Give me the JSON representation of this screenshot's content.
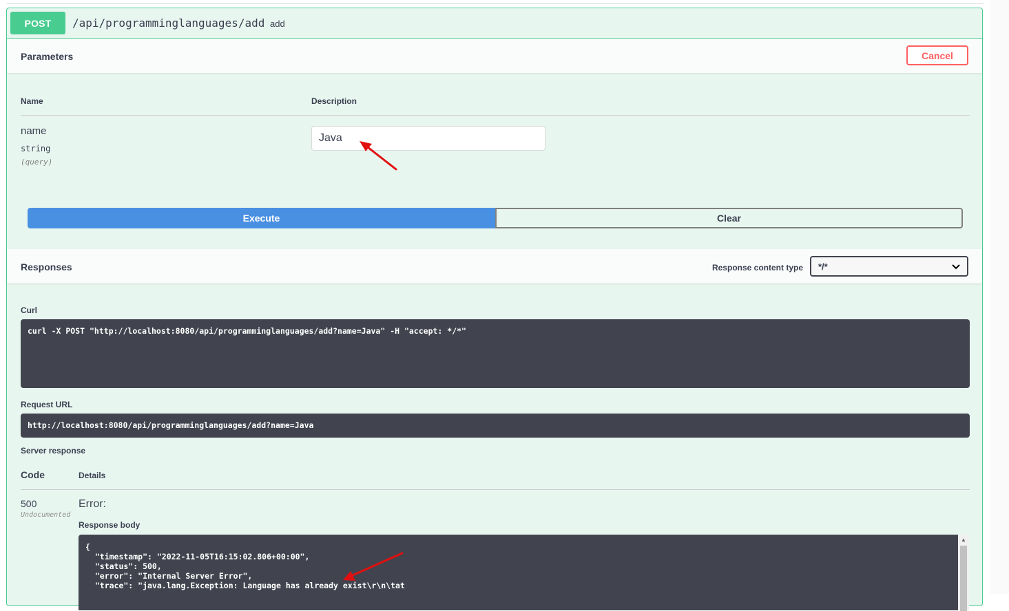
{
  "operation": {
    "method": "POST",
    "path": "/api/programminglanguages/add",
    "summary": "add"
  },
  "parameters": {
    "title": "Parameters",
    "cancel_label": "Cancel",
    "col_name": "Name",
    "col_description": "Description",
    "param": {
      "name": "name",
      "type": "string",
      "in": "(query)",
      "value": "Java"
    }
  },
  "actions": {
    "execute_label": "Execute",
    "clear_label": "Clear"
  },
  "responses": {
    "title": "Responses",
    "content_type_label": "Response content type",
    "content_type_value": "*/*",
    "curl_label": "Curl",
    "curl_command": "curl -X POST \"http://localhost:8080/api/programminglanguages/add?name=Java\" -H \"accept: */*\"",
    "request_url_label": "Request URL",
    "request_url": "http://localhost:8080/api/programminglanguages/add?name=Java",
    "server_response_label": "Server response",
    "col_code": "Code",
    "col_details": "Details",
    "status_code": "500",
    "status_note": "Undocumented",
    "error_title": "Error:",
    "response_body_label": "Response body",
    "response_body": "{\n  \"timestamp\": \"2022-11-05T16:15:02.806+00:00\",\n  \"status\": 500,\n  \"error\": \"Internal Server Error\",\n  \"trace\": \"java.lang.Exception: Language has already exist\\r\\n\\tat"
  },
  "colors": {
    "post_green": "#49cc90",
    "execute_blue": "#4990e2",
    "cancel_red": "#ff6060",
    "code_bg": "#41444e",
    "annotation_red": "#e01010"
  },
  "icons": {
    "select_chevron": "chevron-down-icon",
    "scroll_up": "scroll-up-arrow-icon"
  }
}
